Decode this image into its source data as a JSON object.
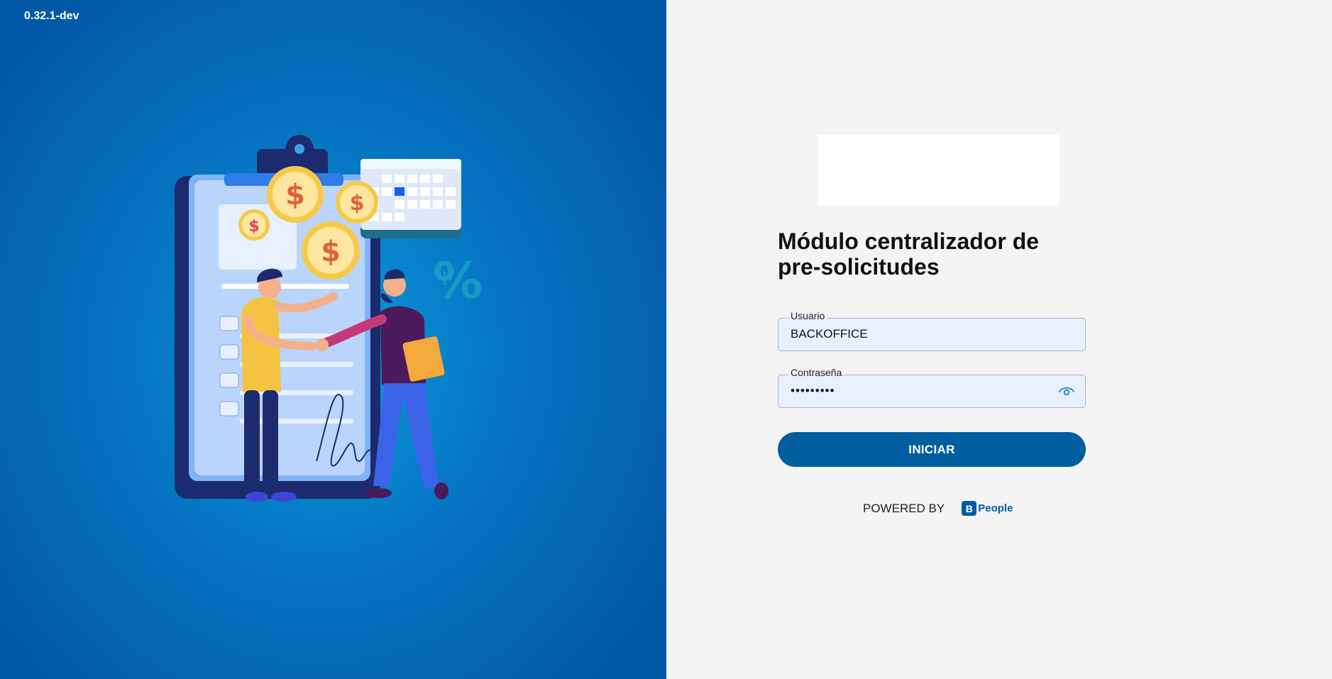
{
  "app": {
    "version": "0.32.1-dev"
  },
  "login": {
    "title_line1": "Módulo centralizador de",
    "title_line2": "pre-solicitudes",
    "user_label": "Usuario",
    "user_value": "BACKOFFICE",
    "password_label": "Contraseña",
    "password_value": "•••••••••",
    "submit_label": "INICIAR"
  },
  "footer": {
    "powered_by": "POWERED BY",
    "brand_icon": "B",
    "brand_name": "People"
  },
  "colors": {
    "primary": "#005e9e",
    "left_panel": "#0677c4",
    "right_panel": "#f4f4f4",
    "field_bg": "#e8f0fe"
  },
  "icons": {
    "password_toggle": "eye-icon",
    "illustration": "handshake-illustration"
  }
}
